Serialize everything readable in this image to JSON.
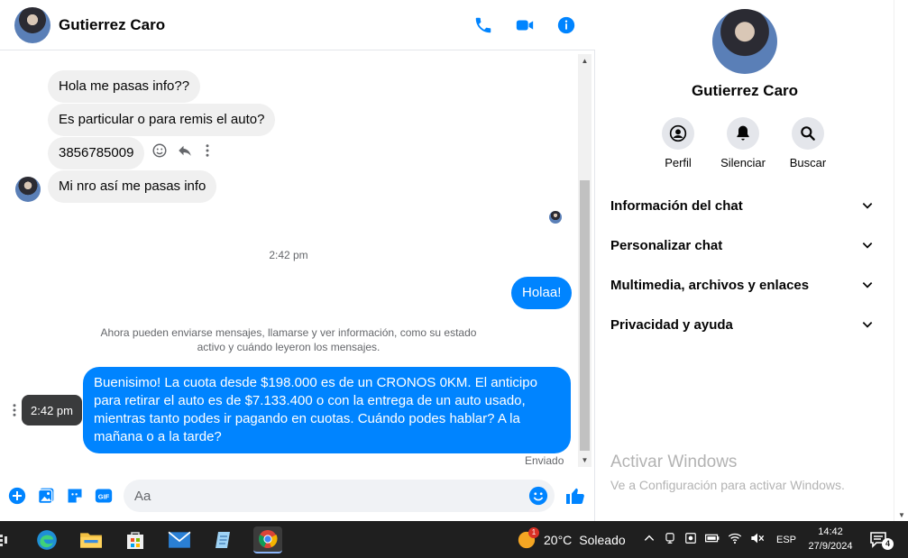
{
  "contact": {
    "name": "Gutierrez Caro"
  },
  "messages": {
    "in1": "Hola me pasas info??",
    "in2": "Es particular o para remis el auto?",
    "in3": "3856785009",
    "in4": "Mi nro así me pasas info",
    "time_divider": "2:42 pm",
    "out1": "Holaa!",
    "system_note_line1": "Ahora pueden enviarse mensajes, llamarse y ver información, como su estado",
    "system_note_line2": "activo y cuándo leyeron los mensajes.",
    "out2": "Buenisimo! La cuota desde $198.000 es de un CRONOS 0KM. El anticipo para retirar el auto es de $7.133.400 o con la entrega de un auto usado, mientras tanto podes ir pagando en cuotas. Cuándo podes hablar? A la mañana o a la tarde?",
    "tooltip_time": "2:42 pm",
    "sent_status": "Enviado"
  },
  "composer": {
    "placeholder": "Aa"
  },
  "panel": {
    "actions": [
      {
        "label": "Perfil",
        "icon": "profile-icon"
      },
      {
        "label": "Silenciar",
        "icon": "bell-icon"
      },
      {
        "label": "Buscar",
        "icon": "search-icon"
      }
    ],
    "sections": [
      "Información del chat",
      "Personalizar chat",
      "Multimedia, archivos y enlaces",
      "Privacidad y ayuda"
    ]
  },
  "watermark": {
    "title": "Activar Windows",
    "subtitle": "Ve a Configuración para activar Windows."
  },
  "taskbar": {
    "weather_temp": "20°C",
    "weather_text": "Soleado",
    "weather_badge": "1",
    "lang": "ESP",
    "time": "14:42",
    "date": "27/9/2024",
    "notif_count": "4"
  },
  "colors": {
    "accent": "#0084ff",
    "incoming_bubble": "#f0f0f0",
    "taskbar": "#1f1f1f"
  }
}
